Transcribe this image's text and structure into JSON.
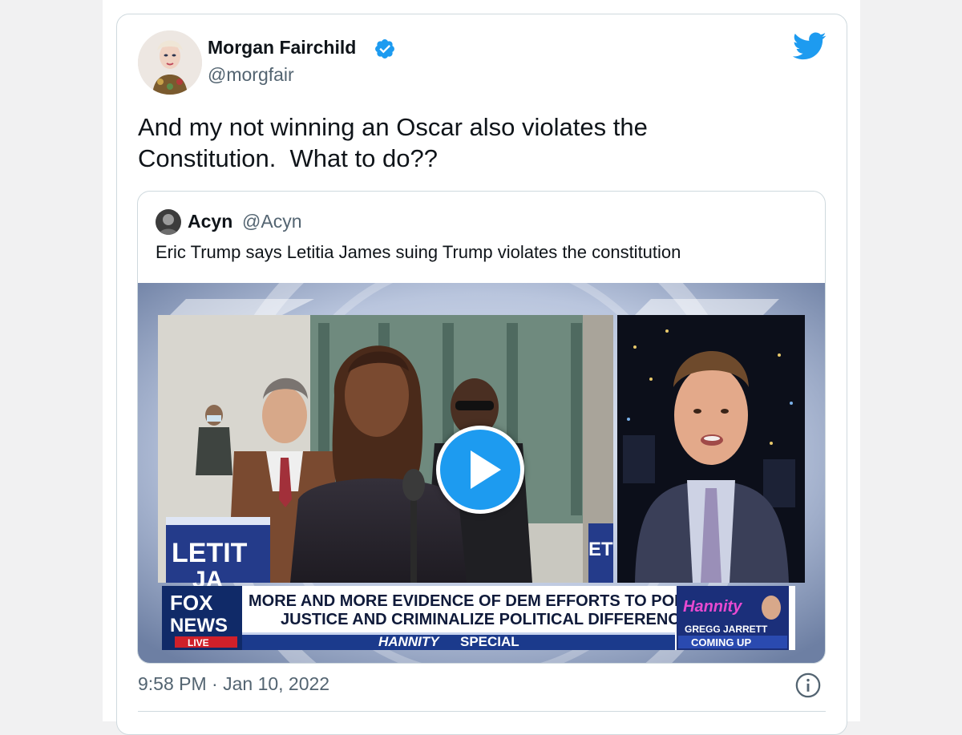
{
  "tweet": {
    "author_name": "Morgan Fairchild",
    "author_handle": "@morgfair",
    "text": "And my not winning an Oscar also violates the\nConstitution.  What to do??",
    "timestamp": "9:58 PM · Jan 10, 2022",
    "icons": {
      "verified": "verified-badge-icon",
      "brand": "twitter-bird-icon",
      "info": "info-icon"
    },
    "colors": {
      "accent": "#1d9bf0",
      "text": "#0f1419",
      "muted": "#536471"
    }
  },
  "quoted_tweet": {
    "author_name": "Acyn",
    "author_handle": "@Acyn",
    "text": "Eric Trump says Letitia James suing Trump violates the constitution",
    "video": {
      "sign_text": "LETIT",
      "sign_text_2": "JA",
      "sign_text_right": "ET",
      "network_line1": "FOX",
      "network_line2": "NEWS",
      "network_live": "LIVE",
      "headline_line1": "MORE AND MORE EVIDENCE OF DEM EFFORTS TO POLITICIZE",
      "headline_line2": "JUSTICE AND CRIMINALIZE POLITICAL DIFFERENCES",
      "show_bar_bold": "HANNITY",
      "show_bar_rest": " SPECIAL",
      "promo_logo": "Hannity",
      "promo_name": "GREGG JARRETT",
      "promo_coming": "COMING UP"
    }
  }
}
